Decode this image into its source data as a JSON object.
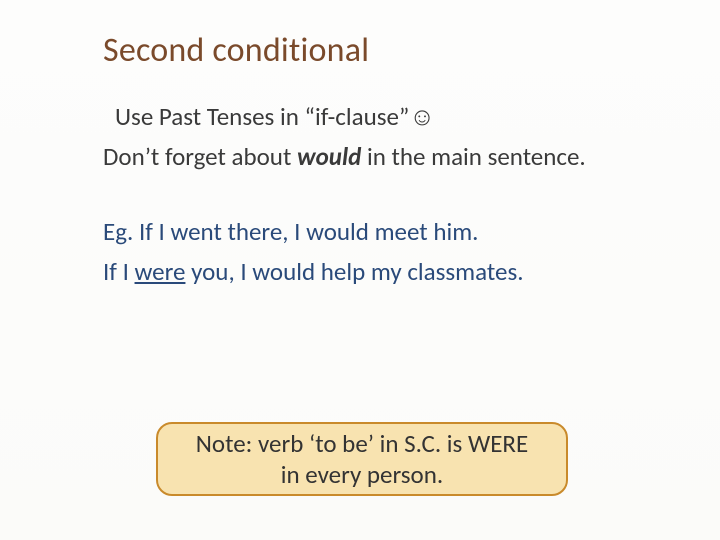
{
  "title": "Second conditional",
  "body": {
    "line1_prefix": "Use Past Tenses in “if-clause”",
    "smiley": "☺",
    "line2_before": "Don’t forget about ",
    "line2_emph": "would",
    "line2_after": " in the main sentence.",
    "example1": "Eg. If I went there, I would meet him.",
    "example2_before": "If I ",
    "example2_underline": "were",
    "example2_after": " you, I would help my classmates."
  },
  "note": {
    "line1": "Note: verb ‘to be’ in S.C. is WERE",
    "line2": "in every person."
  }
}
